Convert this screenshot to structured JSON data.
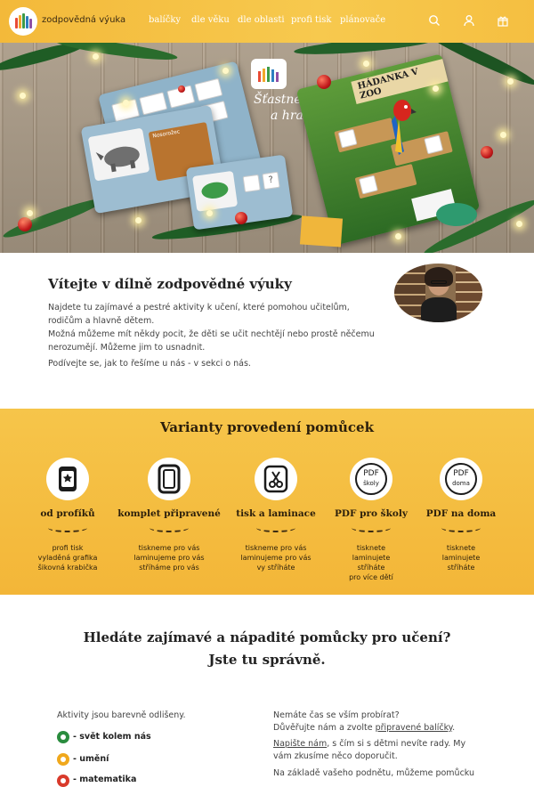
{
  "header": {
    "brand": "zodpovědná výuka",
    "nav": [
      "balíčky",
      "dle věku",
      "dle oblasti",
      "profi tisk",
      "plánovače"
    ],
    "icons": [
      "search-icon",
      "user-icon",
      "gift-icon"
    ]
  },
  "hero": {
    "slogan1": "Šťastné",
    "slogan2": "a hravé...",
    "card_title": "HÁDANKA V ZOO",
    "card_label": "Nosorožec"
  },
  "welcome": {
    "title": "Vítejte v dílně zodpovědné výuky",
    "p1": "Najdete tu zajímavé a pestré aktivity k učení, které pomohou učitelům, rodičům a hlavně dětem.",
    "p2": "Možná můžeme mít někdy pocit, že děti se učit nechtějí nebo prostě něčemu nerozumějí. Můžeme jim to usnadnit.",
    "p3": "Podívejte se, jak to řešíme u nás - v sekci o nás."
  },
  "variants": {
    "title": "Varianty provedení pomůcek",
    "items": [
      {
        "title": "od profíků",
        "icon": "star-tablet-icon",
        "lines": [
          "profi tisk",
          "vyladěná grafika",
          "šikovná krabička"
        ]
      },
      {
        "title": "komplet připravené",
        "icon": "tablet-icon",
        "lines": [
          "tiskneme pro vás",
          "laminujeme pro vás",
          "stříháme pro vás"
        ]
      },
      {
        "title": "tisk a laminace",
        "icon": "scissors-icon",
        "lines": [
          "tiskneme pro vás",
          "laminujeme pro vás",
          "vy stříháte"
        ]
      },
      {
        "title": "PDF pro školy",
        "icon": "pdf-school-icon",
        "badge": [
          "PDF",
          "školy"
        ],
        "lines": [
          "tisknete",
          "laminujete",
          "stříháte",
          "pro více dětí"
        ]
      },
      {
        "title": "PDF na doma",
        "icon": "pdf-home-icon",
        "badge": [
          "PDF",
          "doma"
        ],
        "lines": [
          "tisknete",
          "laminujete",
          "stříháte"
        ]
      }
    ]
  },
  "bottom": {
    "heading1": "Hledáte zajímavé a nápadité pomůcky pro učení?",
    "heading2": "Jste tu správně.",
    "left_intro": "Aktivity jsou barevně odlišeny.",
    "categories": [
      {
        "label": "- svět kolem nás",
        "color": "#2a8c3e"
      },
      {
        "label": "- umění",
        "color": "#f0a81c"
      },
      {
        "label": "- matematika",
        "color": "#d93a2b"
      }
    ],
    "right_l1": "Nemáte čas se vším probírat?",
    "right_l2a": "Důvěřujte nám a zvolte ",
    "right_l2b": "připravené balíčky",
    "right_l2c": ".",
    "right_l3a": "Napište nám",
    "right_l3b": ", s čím si s dětmi nevíte rady. My",
    "right_l4": "vám zkusíme něco doporučit.",
    "right_l5": "Na základě vašeho podnětu, můžeme pomůcku"
  }
}
